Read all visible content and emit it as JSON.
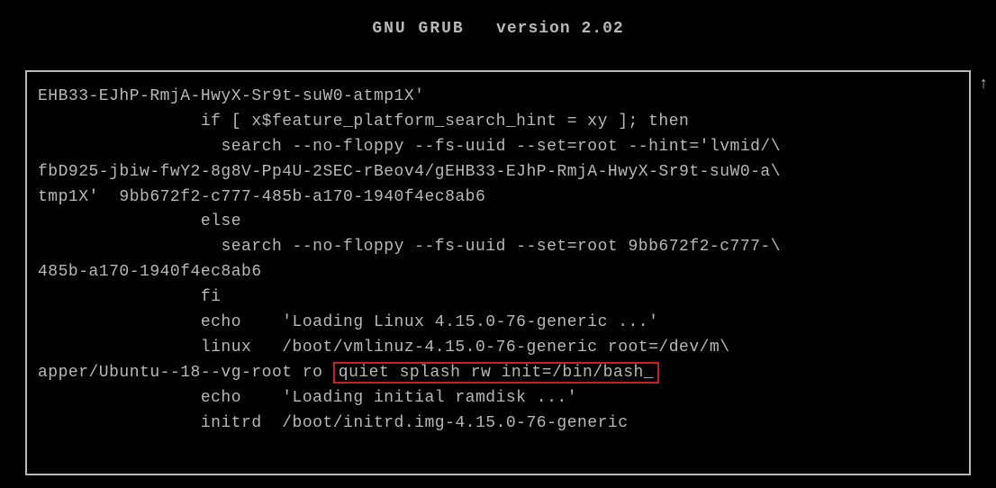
{
  "header": {
    "title_a": "GNU GRUB",
    "title_b": "version 2.02"
  },
  "arrow": "↑",
  "grub": {
    "line1": "EHB33-EJhP-RmjA-HwyX-Sr9t-suW0-atmp1X'",
    "line2": "                if [ x$feature_platform_search_hint = xy ]; then",
    "line3": "                  search --no-floppy --fs-uuid --set=root --hint='lvmid/\\",
    "line4": "fbD925-jbiw-fwY2-8g8V-Pp4U-2SEC-rBeov4/gEHB33-EJhP-RmjA-HwyX-Sr9t-suW0-a\\",
    "line5": "tmp1X'  9bb672f2-c777-485b-a170-1940f4ec8ab6",
    "line6": "                else",
    "line7": "                  search --no-floppy --fs-uuid --set=root 9bb672f2-c777-\\",
    "line8": "485b-a170-1940f4ec8ab6",
    "line9": "                fi",
    "line10": "                echo    'Loading Linux 4.15.0-76-generic ...'",
    "line11": "                linux   /boot/vmlinuz-4.15.0-76-generic root=/dev/m\\",
    "line12_prefix": "apper/Ubuntu--18--vg-root ro ",
    "line12_hl": "quiet splash rw init=/bin/bash_",
    "line13": "                echo    'Loading initial ramdisk ...'",
    "line14": "                initrd  /boot/initrd.img-4.15.0-76-generic"
  }
}
